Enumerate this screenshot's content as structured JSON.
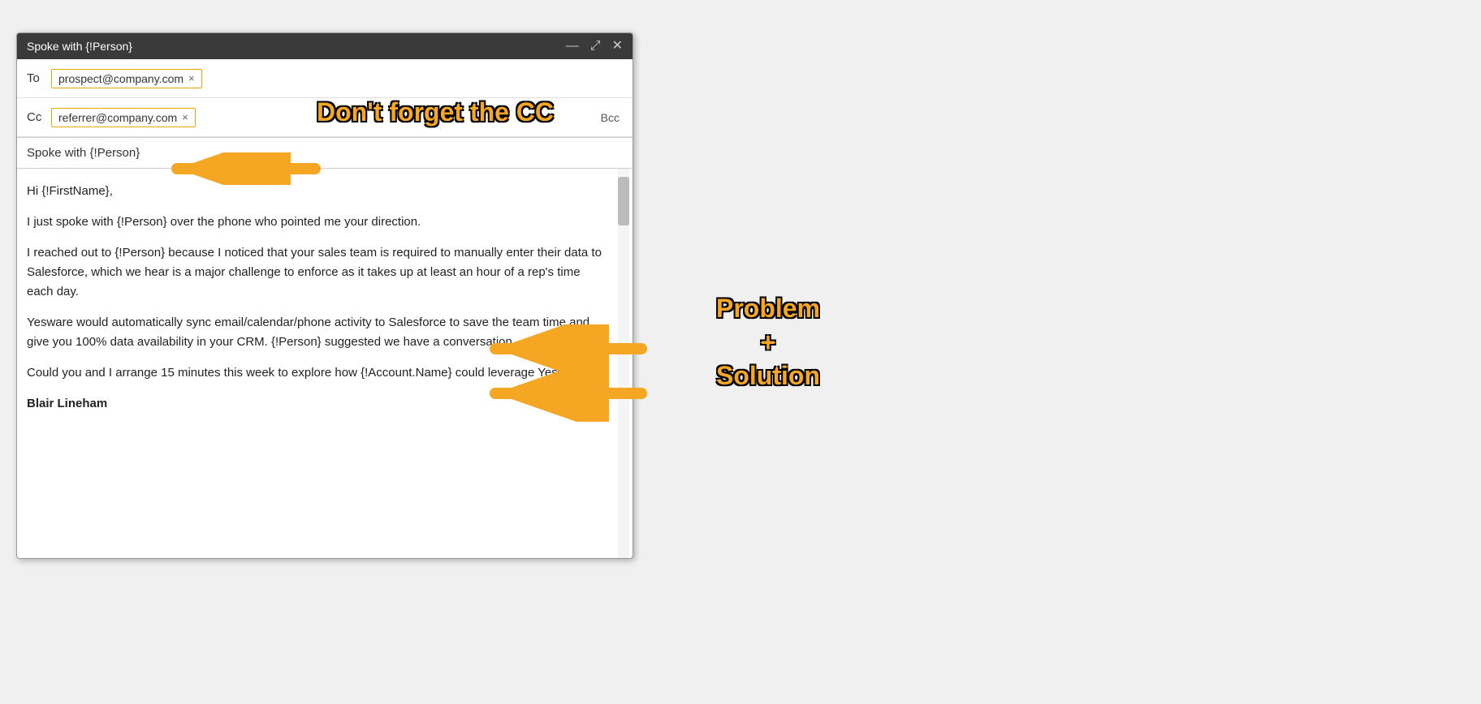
{
  "window": {
    "title": "Spoke with {!Person}",
    "controls": {
      "minimize": "—",
      "maximize": "⤢",
      "close": "✕"
    }
  },
  "fields": {
    "to_label": "To",
    "to_email": "prospect@company.com",
    "cc_label": "Cc",
    "cc_email": "referrer@company.com",
    "bcc_label": "Bcc"
  },
  "subject": "Spoke with {!Person}",
  "body": {
    "greeting": "Hi {!FirstName},",
    "para1": "I just spoke with {!Person} over the phone who pointed me your direction.",
    "para2": "I reached out to {!Person} because I noticed that your sales team is required to manually enter their data to Salesforce, which we hear is a major challenge to enforce as it takes up at least an hour of a rep's time each day.",
    "para3": "Yesware would automatically sync email/calendar/phone activity to Salesforce to save the team time and give you 100% data availability in your CRM. {!Person} suggested we have a conversation.",
    "para4": "Could you and I arrange 15 minutes this week to explore how {!Account.Name} could leverage Yesware?",
    "signature": "Blair Lineham"
  },
  "annotations": {
    "cc_label": "Don't forget the CC",
    "ps_label": "Problem\n+\nSolution"
  }
}
